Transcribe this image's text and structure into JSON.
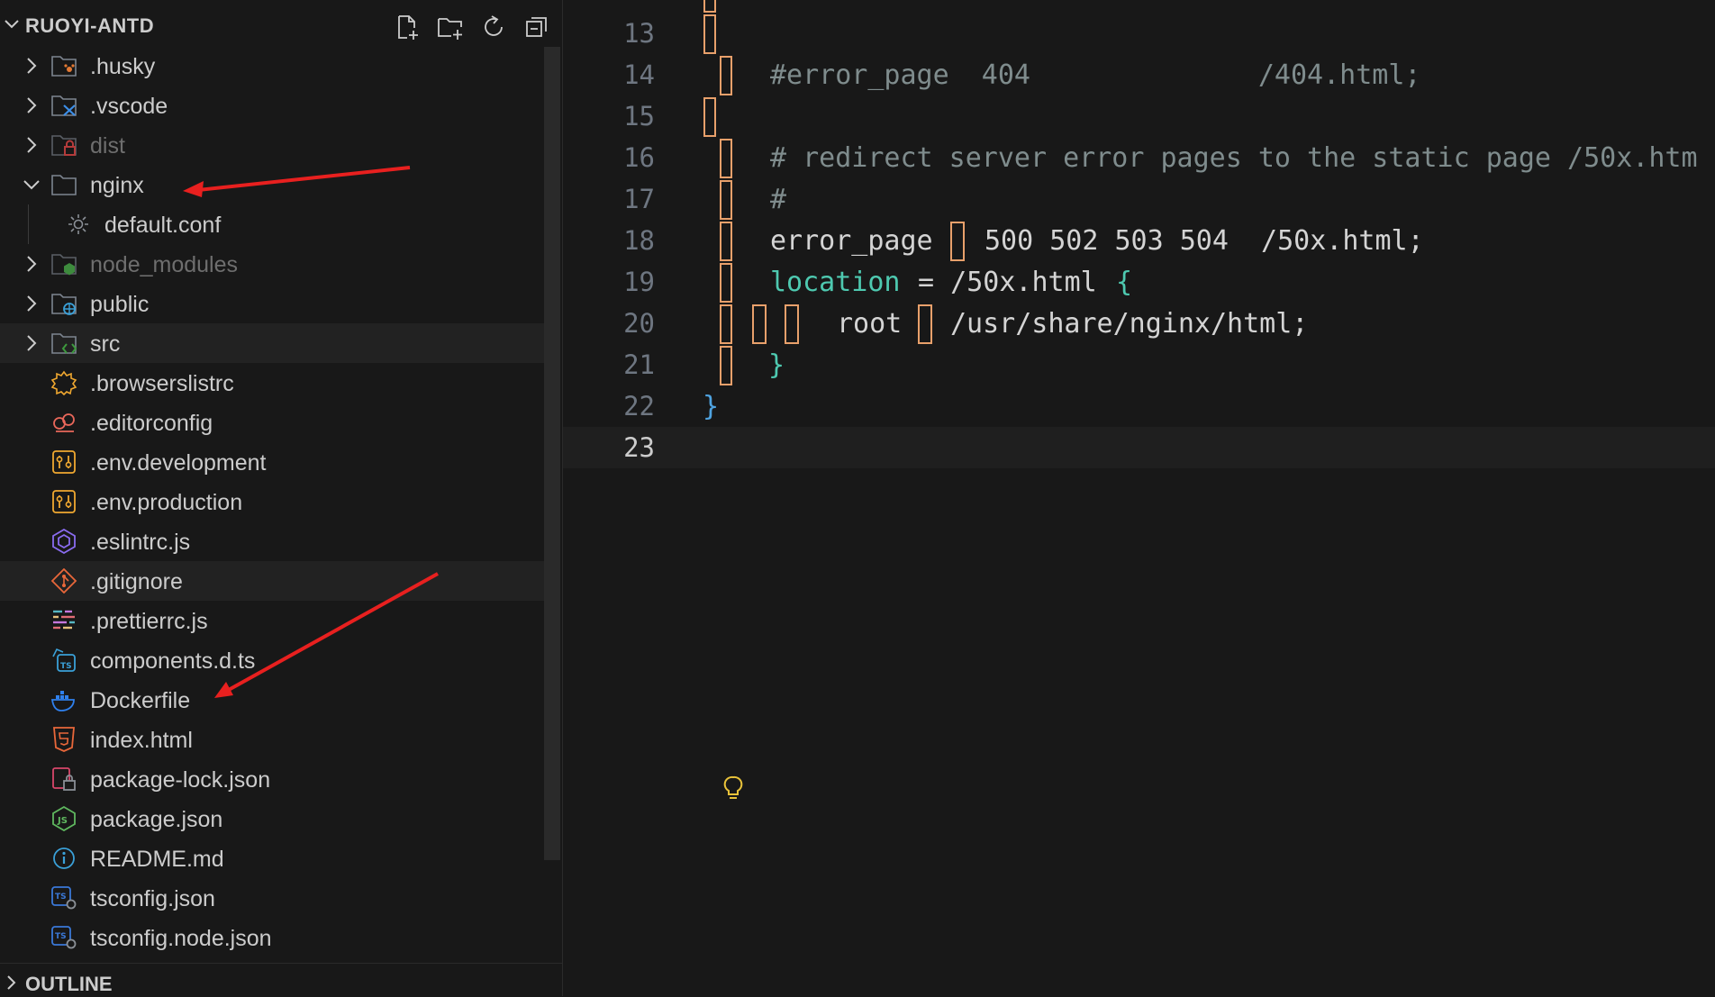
{
  "explorer": {
    "title": "RUOYI-ANTD",
    "actions": [
      "new-file",
      "new-folder",
      "refresh",
      "collapse-all"
    ],
    "items": [
      {
        "label": ".husky",
        "type": "folder",
        "icon": "husky-folder-icon",
        "state": "collapsed"
      },
      {
        "label": ".vscode",
        "type": "folder",
        "icon": "vscode-folder-icon",
        "state": "collapsed"
      },
      {
        "label": "dist",
        "type": "folder",
        "icon": "dist-folder-icon",
        "state": "collapsed",
        "dimmed": true
      },
      {
        "label": "nginx",
        "type": "folder",
        "icon": "folder-icon",
        "state": "expanded"
      },
      {
        "label": "default.conf",
        "type": "file",
        "icon": "gear-icon",
        "indent": 1
      },
      {
        "label": "node_modules",
        "type": "folder",
        "icon": "node-folder-icon",
        "state": "collapsed",
        "dimmed": true
      },
      {
        "label": "public",
        "type": "folder",
        "icon": "public-folder-icon",
        "state": "collapsed"
      },
      {
        "label": "src",
        "type": "folder",
        "icon": "src-folder-icon",
        "state": "collapsed"
      },
      {
        "label": ".browserslistrc",
        "type": "file",
        "icon": "browserslist-icon"
      },
      {
        "label": ".editorconfig",
        "type": "file",
        "icon": "editorconfig-icon"
      },
      {
        "label": ".env.development",
        "type": "file",
        "icon": "env-icon"
      },
      {
        "label": ".env.production",
        "type": "file",
        "icon": "env-icon"
      },
      {
        "label": ".eslintrc.js",
        "type": "file",
        "icon": "eslint-icon"
      },
      {
        "label": ".gitignore",
        "type": "file",
        "icon": "git-icon"
      },
      {
        "label": ".prettierrc.js",
        "type": "file",
        "icon": "prettier-icon"
      },
      {
        "label": "components.d.ts",
        "type": "file",
        "icon": "typescript-def-icon"
      },
      {
        "label": "Dockerfile",
        "type": "file",
        "icon": "docker-icon"
      },
      {
        "label": "index.html",
        "type": "file",
        "icon": "html-icon"
      },
      {
        "label": "package-lock.json",
        "type": "file",
        "icon": "lock-json-icon"
      },
      {
        "label": "package.json",
        "type": "file",
        "icon": "nodejs-icon"
      },
      {
        "label": "README.md",
        "type": "file",
        "icon": "info-icon"
      },
      {
        "label": "tsconfig.json",
        "type": "file",
        "icon": "tsconfig-icon"
      },
      {
        "label": "tsconfig.node.json",
        "type": "file",
        "icon": "tsconfig-icon"
      }
    ]
  },
  "outline": {
    "title": "OUTLINE"
  },
  "editor": {
    "lines": [
      {
        "num": "13",
        "text": ""
      },
      {
        "num": "14",
        "text": "#error_page  404              /404.html;"
      },
      {
        "num": "15",
        "text": ""
      },
      {
        "num": "16",
        "text": "# redirect server error pages to the static page /50x.htm"
      },
      {
        "num": "17",
        "text": "#"
      },
      {
        "num": "18",
        "text_a": "error_page",
        "text_b": "500 502 503 504  /50x.html;"
      },
      {
        "num": "19",
        "kw": "location",
        "text": " = /50x.html ",
        "brace": "{"
      },
      {
        "num": "20",
        "text_a": "root",
        "text_b": "/usr/share/nginx/html;"
      },
      {
        "num": "21",
        "brace": "}"
      },
      {
        "num": "22",
        "brace": "}"
      },
      {
        "num": "23",
        "text": ""
      }
    ]
  },
  "colors": {
    "accent_arrow": "#e8201f",
    "whitespace_box": "#e8a06b"
  }
}
